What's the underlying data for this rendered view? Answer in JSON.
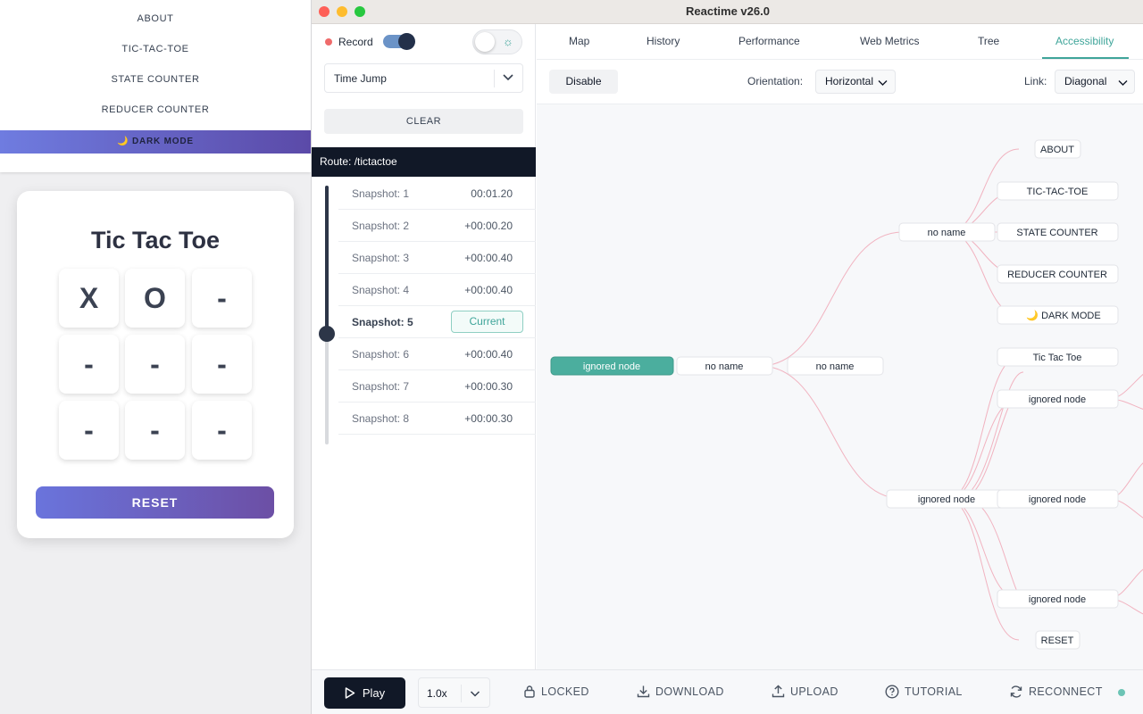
{
  "left_app": {
    "nav": [
      "ABOUT",
      "TIC-TAC-TOE",
      "STATE COUNTER",
      "REDUCER COUNTER"
    ],
    "dark_mode": "🌙 DARK MODE",
    "game": {
      "title": "Tic Tac Toe",
      "cells": [
        "X",
        "O",
        "-",
        "-",
        "-",
        "-",
        "-",
        "-",
        "-"
      ],
      "reset": "RESET"
    }
  },
  "window": {
    "title": "Reactime v26.0",
    "sidebar": {
      "record_label": "Record",
      "dropdown_value": "Time Jump",
      "clear_label": "CLEAR",
      "route": "Route: /tictactoe",
      "snapshots": [
        {
          "name": "Snapshot: 1",
          "time": "00:01.20"
        },
        {
          "name": "Snapshot: 2",
          "time": "+00:00.20"
        },
        {
          "name": "Snapshot: 3",
          "time": "+00:00.40"
        },
        {
          "name": "Snapshot: 4",
          "time": "+00:00.40"
        },
        {
          "name": "Snapshot: 5",
          "time": "Current"
        },
        {
          "name": "Snapshot: 6",
          "time": "+00:00.40"
        },
        {
          "name": "Snapshot: 7",
          "time": "+00:00.30"
        },
        {
          "name": "Snapshot: 8",
          "time": "+00:00.30"
        }
      ]
    },
    "tabs": [
      "Map",
      "History",
      "Performance",
      "Web Metrics",
      "Tree",
      "Accessibility"
    ],
    "active_tab": "Accessibility",
    "toolbar": {
      "disable_label": "Disable",
      "orientation_label": "Orientation:",
      "orientation_value": "Horizontal",
      "link_label": "Link:",
      "link_value": "Diagonal"
    },
    "tree": {
      "nodes": [
        "ignored node",
        "no name",
        "no name",
        "no name",
        "ignored node",
        "ABOUT",
        "TIC-TAC-TOE",
        "STATE COUNTER",
        "REDUCER COUNTER",
        "🌙 DARK MODE",
        "Tic Tac Toe",
        "ignored node",
        "ignored node",
        "ignored node",
        "RESET"
      ]
    },
    "footer": {
      "play": "Play",
      "speed": "1.0x",
      "locked": "LOCKED",
      "download": "DOWNLOAD",
      "upload": "UPLOAD",
      "tutorial": "TUTORIAL",
      "reconnect": "RECONNECT"
    },
    "colors": {
      "accent": "#3fa59a",
      "link": "#f1b3c0",
      "dark": "#111827"
    }
  }
}
